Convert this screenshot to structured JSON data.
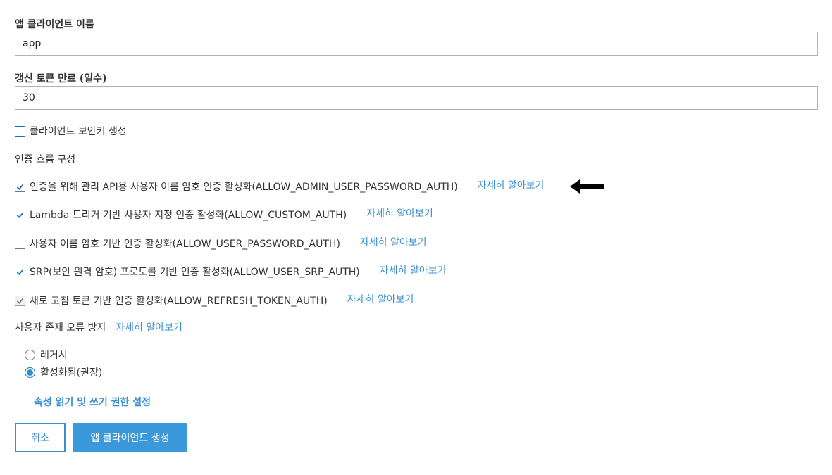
{
  "app_client_name": {
    "label": "앱 클라이언트 이름",
    "value": "app"
  },
  "refresh_token": {
    "label": "갱신 토큰 만료 (일수)",
    "value": "30"
  },
  "secret_checkbox": {
    "label": "클라이언트 보안키 생성",
    "checked": false
  },
  "auth_flow": {
    "section_label": "인증 흐름 구성",
    "learn_more": "자세히 알아보기",
    "items": [
      {
        "label": "인증을 위해 관리 API용 사용자 이름 암호 인증 활성화(ALLOW_ADMIN_USER_PASSWORD_AUTH)",
        "checked": true
      },
      {
        "label": "Lambda 트리거 기반 사용자 지정 인증 활성화(ALLOW_CUSTOM_AUTH)",
        "checked": true
      },
      {
        "label": "사용자 이름 암호 기반 인증 활성화(ALLOW_USER_PASSWORD_AUTH)",
        "checked": false
      },
      {
        "label": "SRP(보안 원격 암호) 프로토콜 기반 인증 활성화(ALLOW_USER_SRP_AUTH)",
        "checked": true
      },
      {
        "label": "새로 고침 토큰 기반 인증 활성화(ALLOW_REFRESH_TOKEN_AUTH)",
        "checked": true,
        "disabled": true
      }
    ]
  },
  "user_existence": {
    "label": "사용자 존재 오류 방지",
    "learn_more": "자세히 알아보기",
    "options": [
      {
        "label": "레거시",
        "selected": false
      },
      {
        "label": "활성화됨(권장)",
        "selected": true
      }
    ]
  },
  "attribute_link": "속성 읽기 및 쓰기 권한 설정",
  "buttons": {
    "cancel": "취소",
    "create": "앱 클라이언트 생성"
  },
  "colors": {
    "accent": "#3b8fd0",
    "primary_button": "#3b99db",
    "checkbox_check": "#1b6fb3"
  }
}
